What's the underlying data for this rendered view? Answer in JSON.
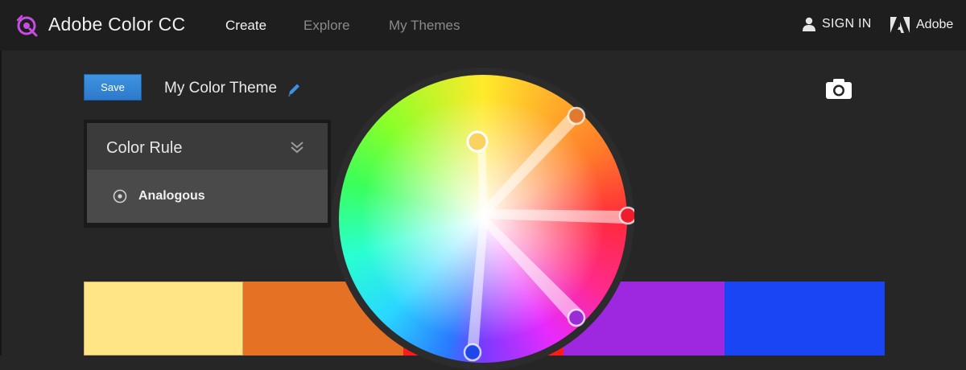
{
  "app": {
    "title": "Adobe Color CC"
  },
  "nav": [
    {
      "label": "Create",
      "active": true
    },
    {
      "label": "Explore",
      "active": false
    },
    {
      "label": "My Themes",
      "active": false
    }
  ],
  "account": {
    "signin_label": "SIGN IN",
    "adobe_label": "Adobe"
  },
  "toolbar": {
    "save_label": "Save",
    "theme_name": "My Color Theme"
  },
  "color_rule": {
    "title": "Color Rule",
    "selected": "Analogous"
  },
  "swatches": [
    {
      "color": "#ffe585"
    },
    {
      "color": "#e57224"
    },
    {
      "color": "#ff1a1a"
    },
    {
      "color": "#9e27e0"
    },
    {
      "color": "#1a45f5"
    }
  ],
  "wheel_markers": [
    {
      "color": "#f9d260",
      "base": true
    },
    {
      "color": "#e07b2e",
      "base": false
    },
    {
      "color": "#ee1c2c",
      "base": false
    },
    {
      "color": "#9b2bd6",
      "base": false
    },
    {
      "color": "#1d47e8",
      "base": false
    }
  ],
  "colors": {
    "accent": "#2d79cc",
    "background": "#262626",
    "topbar": "#1e1e1e"
  }
}
